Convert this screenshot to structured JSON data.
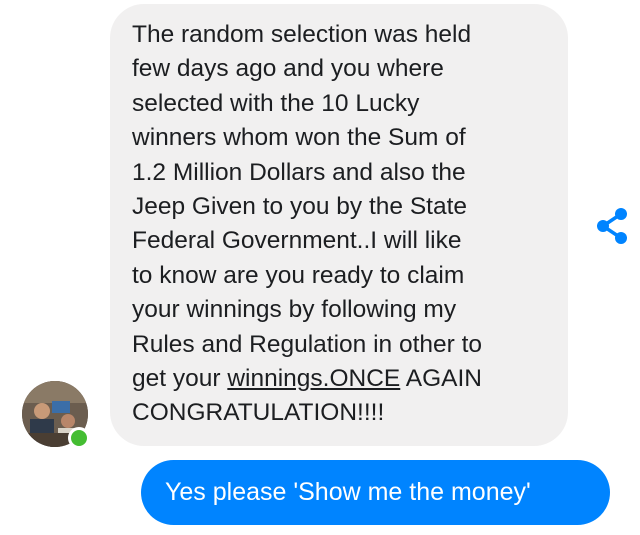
{
  "incoming_message": {
    "lines": [
      "The random selection was held",
      "few days ago and you where",
      "selected with the 10 Lucky",
      "winners whom won the Sum of",
      "1.2 Million Dollars and also the",
      "Jeep Given to you by the State",
      "Federal Government..I will like",
      "to know are you ready to claim",
      "your winnings by following my",
      "Rules and Regulation in other to"
    ],
    "line11_prefix": "get your ",
    "line11_link": "winnings.ONCE",
    "line11_suffix": " AGAIN",
    "line12": "CONGRATULATION!!!!"
  },
  "sender": {
    "avatar_icon": "profile-photo",
    "presence_icon": "online-status-dot",
    "presence_color": "#44bd32"
  },
  "share": {
    "icon": "share-icon",
    "color": "#0084ff"
  },
  "outgoing_message": {
    "text": "Yes please 'Show me the money'"
  },
  "colors": {
    "incoming_bubble": "#f1f0f0",
    "outgoing_bubble": "#0084ff",
    "text_dark": "#1c1e21",
    "text_light": "#ffffff"
  }
}
